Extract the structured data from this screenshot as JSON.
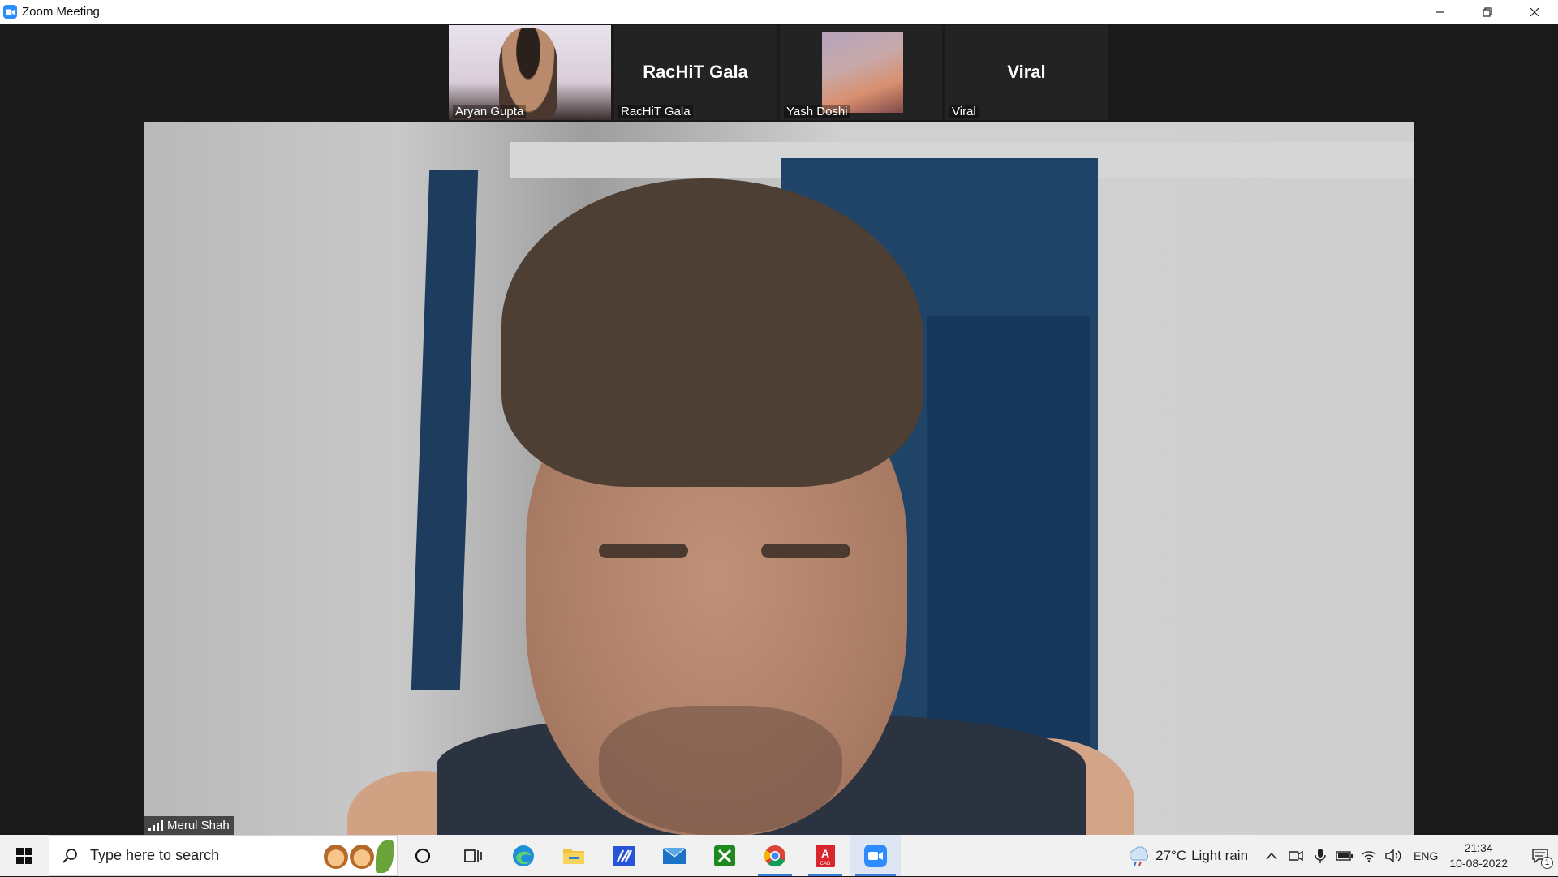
{
  "window": {
    "title": "Zoom Meeting",
    "controls": {
      "minimize": "—",
      "restore": "❐",
      "close": "✕"
    }
  },
  "participants_strip": [
    {
      "label": "Aryan Gupta",
      "display_name": "",
      "video": "camera"
    },
    {
      "label": "RacHiT Gala",
      "display_name": "RacHiT Gala",
      "video": "off"
    },
    {
      "label": "Yash Doshi",
      "display_name": "",
      "video": "avatar"
    },
    {
      "label": "Viral",
      "display_name": "Viral",
      "video": "off"
    }
  ],
  "active_speaker": {
    "name": "Merul Shah"
  },
  "taskbar": {
    "search_placeholder": "Type here to search",
    "apps": [
      {
        "name": "cortana-icon",
        "active": false
      },
      {
        "name": "task-view-icon",
        "active": false
      },
      {
        "name": "edge-icon",
        "active": false
      },
      {
        "name": "file-explorer-icon",
        "active": false
      },
      {
        "name": "vs-code-icon",
        "active": false
      },
      {
        "name": "mail-icon",
        "active": false
      },
      {
        "name": "xbox-icon",
        "active": false
      },
      {
        "name": "chrome-icon",
        "active": false,
        "running": true
      },
      {
        "name": "autocad-icon",
        "active": false,
        "running": true
      },
      {
        "name": "zoom-icon",
        "active": true
      }
    ],
    "weather": {
      "temp": "27°C",
      "condition": "Light rain"
    },
    "language": "ENG",
    "time": "21:34",
    "date": "10-08-2022",
    "notification_count": "1"
  }
}
